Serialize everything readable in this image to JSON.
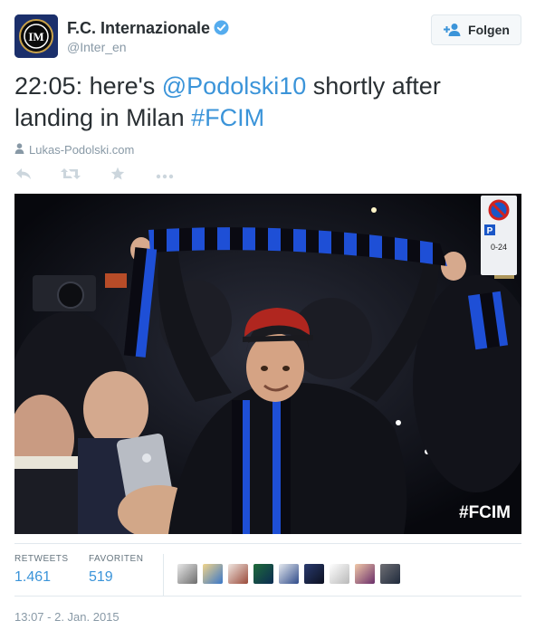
{
  "account": {
    "name": "F.C. Internazionale",
    "handle": "@Inter_en",
    "verified": true,
    "avatar_icon": "inter-crest-icon"
  },
  "follow_button": {
    "label": "Folgen",
    "icon": "add-user-icon"
  },
  "tweet": {
    "prefix": "22:05: here's ",
    "mention": "@Podolski10",
    "middle": " shortly after landing in Milan ",
    "hashtag": "#FCIM"
  },
  "source": {
    "icon": "person-icon",
    "label": "Lukas-Podolski.com"
  },
  "actions": [
    {
      "icon": "reply-icon"
    },
    {
      "icon": "retweet-icon"
    },
    {
      "icon": "favorite-star-icon"
    },
    {
      "icon": "more-dots-icon"
    }
  ],
  "photo": {
    "overlay_hashtag": "#FCIM"
  },
  "stats": {
    "retweets_label": "RETWEETS",
    "retweets_value": "1.461",
    "favorites_label": "FAVORITEN",
    "favorites_value": "519"
  },
  "timestamp": "13:07 - 2. Jan. 2015",
  "colors": {
    "link": "#3b94d9",
    "muted": "#8899a6",
    "verified": "#55acee",
    "inter_blue": "#1e4fd6"
  }
}
